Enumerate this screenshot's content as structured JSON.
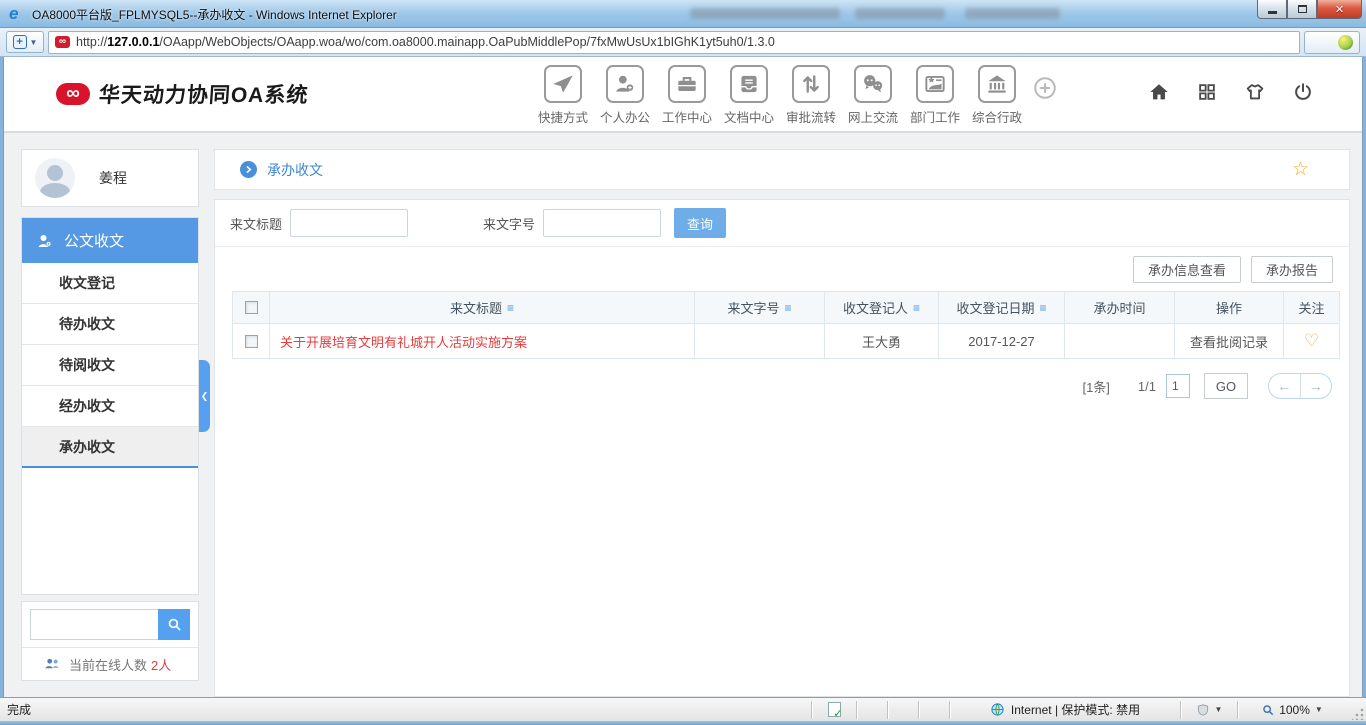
{
  "browser": {
    "title": "OA8000平台版_FPLMYSQL5--承办收文 - Windows Internet Explorer",
    "url_protocol": "http://",
    "url_host": "127.0.0.1",
    "url_path": "/OAapp/WebObjects/OAapp.woa/wo/com.oa8000.mainapp.OaPubMiddlePop/7fxMwUsUx1bIGhK1yt5uh0/1.3.0",
    "status": {
      "left": "完成",
      "zone_text": "Internet | 保护模式: 禁用",
      "zoom_level": "100%"
    }
  },
  "app": {
    "logo_text": "华天动力协同OA系统",
    "logo_mark": "∞",
    "nav": [
      {
        "label": "快捷方式",
        "icon": "paper-plane-icon"
      },
      {
        "label": "个人办公",
        "icon": "person-add-icon"
      },
      {
        "label": "工作中心",
        "icon": "briefcase-icon"
      },
      {
        "label": "文档中心",
        "icon": "document-tray-icon"
      },
      {
        "label": "审批流转",
        "icon": "up-down-arrows-icon"
      },
      {
        "label": "网上交流",
        "icon": "chat-bubbles-icon"
      },
      {
        "label": "部门工作",
        "icon": "picture-star-icon"
      },
      {
        "label": "综合行政",
        "icon": "bank-icon"
      }
    ],
    "header_right": [
      "home-icon",
      "apps-grid-icon",
      "theme-shirt-icon",
      "power-icon"
    ]
  },
  "sidebar": {
    "user_name": "姜程",
    "section_title": "公文收文",
    "items": [
      {
        "label": "收文登记",
        "active": false
      },
      {
        "label": "待办收文",
        "active": false
      },
      {
        "label": "待阅收文",
        "active": false
      },
      {
        "label": "经办收文",
        "active": false
      },
      {
        "label": "承办收文",
        "active": true
      }
    ],
    "online_label": "当前在线人数",
    "online_count": "2人"
  },
  "main": {
    "breadcrumb": "承办收文",
    "filters": {
      "title_label": "来文标题",
      "title_value": "",
      "docno_label": "来文字号",
      "docno_value": "",
      "search_button": "查询"
    },
    "action_buttons": [
      {
        "label": "承办信息查看"
      },
      {
        "label": "承办报告"
      }
    ],
    "table": {
      "columns": [
        {
          "label": "来文标题",
          "sortable": true
        },
        {
          "label": "来文字号",
          "sortable": true
        },
        {
          "label": "收文登记人",
          "sortable": true
        },
        {
          "label": "收文登记日期",
          "sortable": true
        },
        {
          "label": "承办时间",
          "sortable": false
        },
        {
          "label": "操作",
          "sortable": false
        },
        {
          "label": "关注",
          "sortable": false
        }
      ],
      "sort_glyph": "≡",
      "rows": [
        {
          "title": "关于开展培育文明有礼城开人活动实施方案",
          "docno": "",
          "registrant": "王大勇",
          "reg_date": "2017-12-27",
          "handle_time": "",
          "action": "查看批阅记录",
          "follow_icon": "heart-icon"
        }
      ]
    },
    "pagination": {
      "total": "[1条]",
      "page": "1/1",
      "page_input": "1",
      "go_label": "GO",
      "prev_glyph": "←",
      "next_glyph": "→"
    }
  },
  "colors": {
    "accent_blue": "#5598e3",
    "breadcrumb_blue": "#3f87d2",
    "row_red": "#e53c3c",
    "star_orange": "#f0ad1e",
    "heart_orange": "#f5a93c",
    "logo_red": "#d8132a"
  }
}
